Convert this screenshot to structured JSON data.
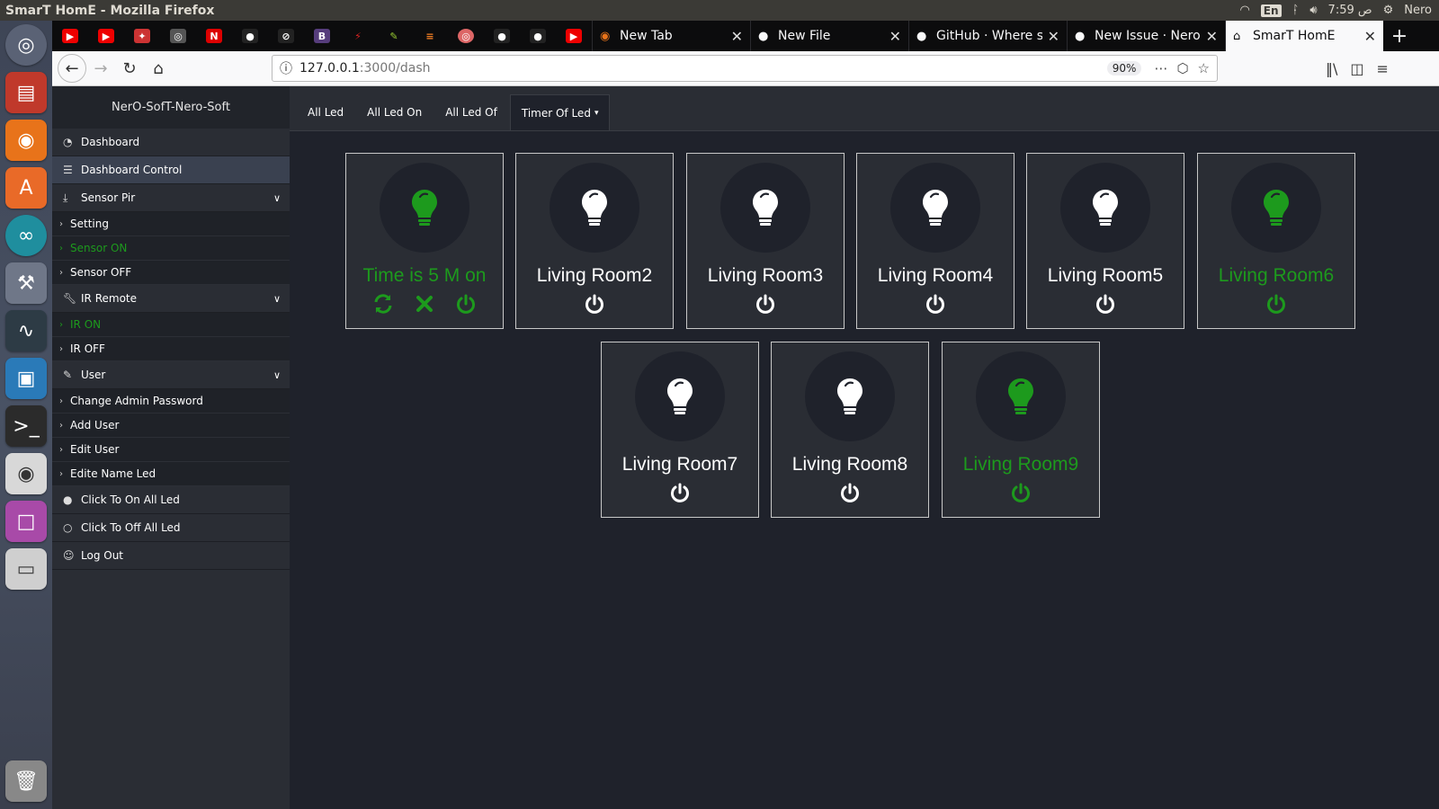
{
  "os": {
    "window_title": "SmarT HomE - Mozilla Firefox",
    "lang": "En",
    "clock": "7:59 ص",
    "user": "Nero"
  },
  "browser": {
    "tabs": [
      {
        "label": "New Tab",
        "icon": "firefox-icon"
      },
      {
        "label": "New File",
        "icon": "github-icon"
      },
      {
        "label": "GitHub · Where so",
        "icon": "github-icon"
      },
      {
        "label": "New Issue · Nero",
        "icon": "github-icon"
      },
      {
        "label": "SmarT HomE",
        "icon": "home-icon"
      }
    ],
    "url_host": "127.0.0.1",
    "url_path": ":3000/dash",
    "zoom": "90%"
  },
  "sidebar": {
    "brand": "NerO-SofT-Nero-Soft",
    "dashboard": "Dashboard",
    "dashboard_control": "Dashboard Control",
    "sensor_pir": "Sensor Pir",
    "setting": "Setting",
    "sensor_on": "Sensor ON",
    "sensor_off": "Sensor OFF",
    "ir_remote": "IR Remote",
    "ir_on": "IR ON",
    "ir_off": "IR OFF",
    "user": "User",
    "change_admin_password": "Change Admin Password",
    "add_user": "Add User",
    "edit_user": "Edit User",
    "edit_name_led": "Edite Name Led",
    "click_on_all": "Click To On All Led",
    "click_off_all": "Click To Off All Led",
    "log_out": "Log Out"
  },
  "main": {
    "tabs": [
      "All Led",
      "All Led On",
      "All Led Of",
      "Timer Of Led"
    ],
    "cards": [
      {
        "name": "Time is 5 M on",
        "on": true
      },
      {
        "name": "Living Room2",
        "on": false
      },
      {
        "name": "Living Room3",
        "on": false
      },
      {
        "name": "Living Room4",
        "on": false
      },
      {
        "name": "Living Room5",
        "on": false
      },
      {
        "name": "Living Room6",
        "on": true
      },
      {
        "name": "Living Room7",
        "on": false
      },
      {
        "name": "Living Room8",
        "on": false
      },
      {
        "name": "Living Room9",
        "on": true
      }
    ]
  },
  "colors": {
    "on": "#1d9a1d",
    "off": "#ffffff"
  }
}
